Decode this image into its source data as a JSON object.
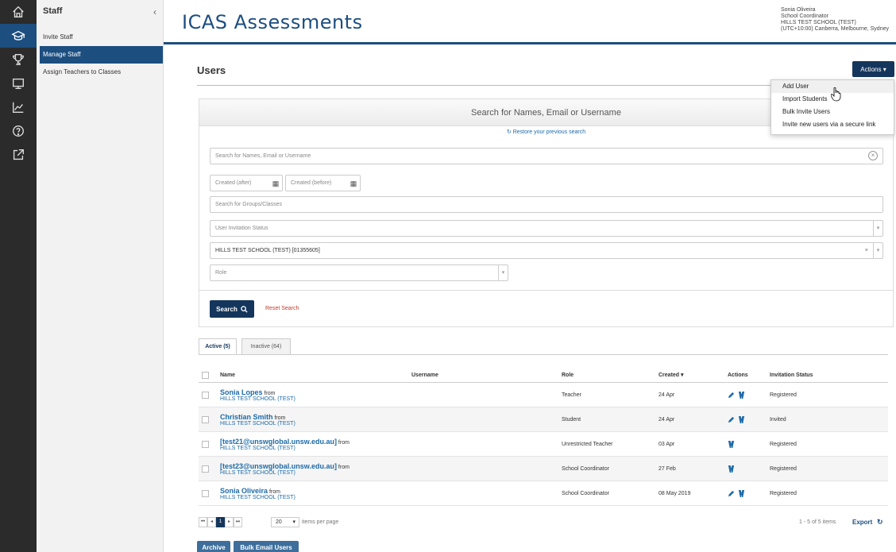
{
  "app": {
    "title": "ICAS Assessments"
  },
  "user": {
    "name": "Sonia Oliveira",
    "role": "School Coordinator",
    "school": "HILLS TEST SCHOOL (TEST)",
    "timezone": "(UTC+10:00) Canberra, Melbourne, Sydney"
  },
  "rail_icons": [
    "home-icon",
    "graduation-cap-icon",
    "trophy-icon",
    "monitor-icon",
    "chart-icon",
    "help-icon",
    "external-link-icon"
  ],
  "sidebar": {
    "title": "Staff",
    "items": [
      {
        "label": "Invite Staff"
      },
      {
        "label": "Manage Staff"
      },
      {
        "label": "Assign Teachers to Classes"
      }
    ]
  },
  "page": {
    "title": "Users",
    "actions_label": "Actions ▾"
  },
  "actions_menu": [
    {
      "label": "Add User"
    },
    {
      "label": "Import Students"
    },
    {
      "label": "Bulk Invite Users"
    },
    {
      "label": "Invite new users via a secure link"
    }
  ],
  "search": {
    "heading": "Search for Names, Email or Username",
    "restore_label": "Restore your previous search",
    "name_placeholder": "Search for Names, Email or Username",
    "created_after": "Created (after)",
    "created_before": "Created (before)",
    "groups_placeholder": "Search for Groups/Classes",
    "invitation_status_placeholder": "User Invitation Status",
    "school_value": "HILLS TEST SCHOOL (TEST) [01355605]",
    "role_placeholder": "Role",
    "search_button": "Search",
    "reset_link": "Reset Search"
  },
  "tabs": [
    {
      "label": "Active (5)"
    },
    {
      "label": "Inactive (64)"
    }
  ],
  "table": {
    "headers": {
      "name": "Name",
      "username": "Username",
      "role": "Role",
      "created": "Created ▾",
      "actions": "Actions",
      "invitation_status": "Invitation Status"
    },
    "from_label": "from",
    "rows": [
      {
        "name": "Sonia Lopes",
        "school": "HILLS TEST SCHOOL (TEST)",
        "username": "",
        "role": "Teacher",
        "created": "24 Apr",
        "status": "Registered"
      },
      {
        "name": "Christian Smith",
        "school": "HILLS TEST SCHOOL (TEST)",
        "username": "",
        "role": "Student",
        "created": "24 Apr",
        "status": "Invited"
      },
      {
        "name": "[test21@unswglobal.unsw.edu.au]",
        "school": "HILLS TEST SCHOOL (TEST)",
        "username": "",
        "role": "Unrestricted Teacher",
        "created": "03 Apr",
        "status": "Registered"
      },
      {
        "name": "[test23@unswglobal.unsw.edu.au]",
        "school": "HILLS TEST SCHOOL (TEST)",
        "username": "",
        "role": "School Coordinator",
        "created": "27 Feb",
        "status": "Registered"
      },
      {
        "name": "Sonia Oliveira",
        "school": "HILLS TEST SCHOOL (TEST)",
        "username": "",
        "role": "School Coordinator",
        "created": "08 May 2019",
        "status": "Registered"
      }
    ]
  },
  "pager": {
    "current_page": "1",
    "page_size": "20",
    "items_per_page_label": "items per page",
    "count_label": "1 - 5 of 5 items",
    "export_label": "Export"
  },
  "bottom_buttons": {
    "archive": "Archive",
    "bulk_email": "Bulk Email Users"
  },
  "colors": {
    "primary": "#1c4e80",
    "dark_button": "#14365c",
    "link": "#1c6aa8",
    "reset": "#c0392b",
    "rail": "#2b2b2b"
  }
}
